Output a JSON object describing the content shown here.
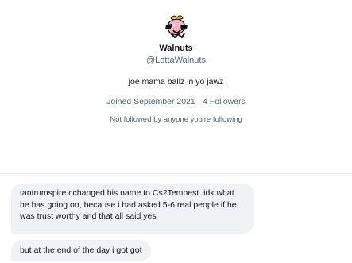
{
  "profile": {
    "display_name": "Walnuts",
    "handle": "@LottaWalnuts",
    "bio": "joe mama ballz in yo jawz",
    "joined": "Joined September 2021",
    "separator": "·",
    "followers": "4 Followers",
    "followed_by": "Not followed by anyone you're following"
  },
  "messages": [
    {
      "text": "tantrumspire cchanged his name to Cs2Tempest. idk what he has going on, because i had asked 5-6 real people if he was trust worthy and that all said yes"
    },
    {
      "text": "but at the end of the day i got got"
    }
  ],
  "colors": {
    "text_primary": "#0f1419",
    "text_secondary": "#536471",
    "bubble_bg": "#eff3f4",
    "avatar_pink": "#f7b3c6",
    "avatar_yellow": "#f5c542"
  }
}
